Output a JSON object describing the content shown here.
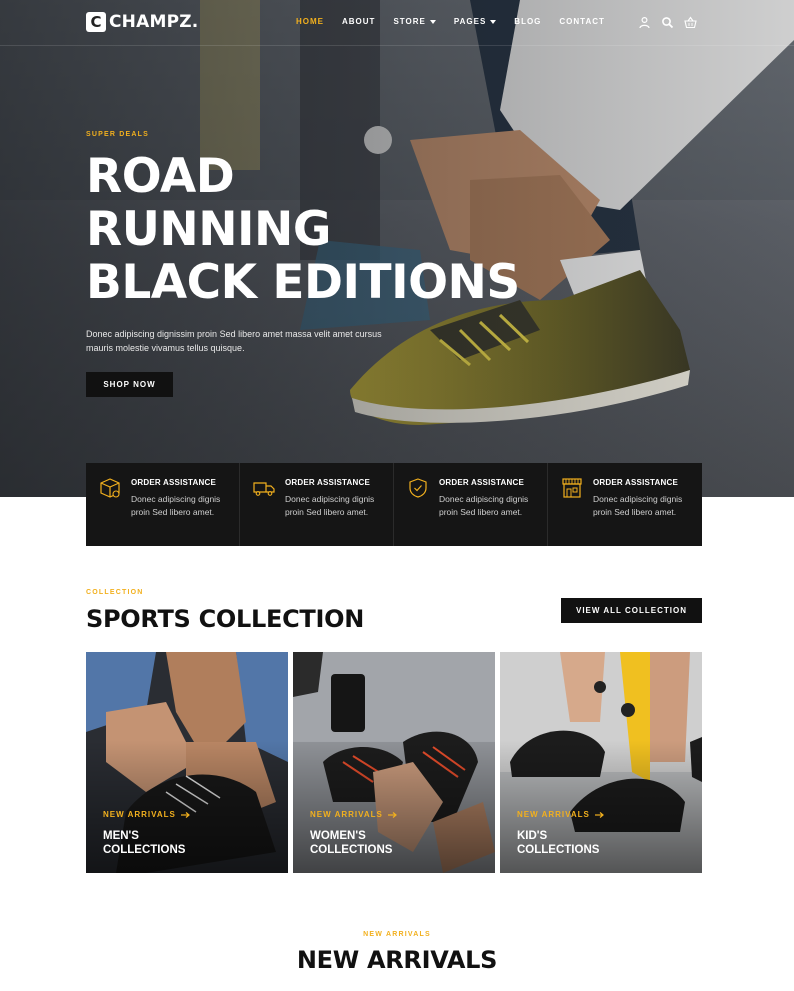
{
  "nav": {
    "logo_letter": "C",
    "logo_text": "CHAMPZ.",
    "items": [
      {
        "label": "HOME",
        "active": true
      },
      {
        "label": "ABOUT"
      },
      {
        "label": "STORE"
      },
      {
        "label": "PAGES"
      },
      {
        "label": "BLOG"
      },
      {
        "label": "CONTACT"
      }
    ],
    "icons": [
      "user-icon",
      "search-icon",
      "basket-icon"
    ]
  },
  "hero": {
    "eyebrow": "SUPER DEALS",
    "title_line1": "ROAD",
    "title_line2": "RUNNING",
    "title_line3": "BLACK EDITIONS",
    "description": "Donec adipiscing dignissim proin Sed libero amet massa velit amet cursus mauris molestie vivamus tellus quisque.",
    "button": "SHOP NOW"
  },
  "features": [
    {
      "icon": "box-icon",
      "title": "ORDER ASSISTANCE",
      "text": "Donec adipiscing dignis proin Sed libero amet."
    },
    {
      "icon": "truck-icon",
      "title": "ORDER ASSISTANCE",
      "text": "Donec adipiscing dignis proin Sed libero amet."
    },
    {
      "icon": "shield-icon",
      "title": "ORDER ASSISTANCE",
      "text": "Donec adipiscing dignis proin Sed libero amet."
    },
    {
      "icon": "store-icon",
      "title": "ORDER ASSISTANCE",
      "text": "Donec adipiscing dignis proin Sed libero amet."
    }
  ],
  "collection": {
    "eyebrow": "COLLECTION",
    "title": "SPORTS COLLECTION",
    "button": "VIEW ALL COLLECTION",
    "cards": [
      {
        "tag": "NEW ARRIVALS",
        "title_line1": "MEN'S",
        "title_line2": "COLLECTIONS"
      },
      {
        "tag": "NEW ARRIVALS",
        "title_line1": "WOMEN'S",
        "title_line2": "COLLECTIONS"
      },
      {
        "tag": "NEW ARRIVALS",
        "title_line1": "KID'S",
        "title_line2": "COLLECTIONS"
      }
    ]
  },
  "new_arrivals": {
    "eyebrow": "NEW ARRIVALS",
    "title": "NEW ARRIVALS"
  },
  "colors": {
    "accent": "#f2b01e",
    "dark": "#151515",
    "white": "#ffffff"
  }
}
